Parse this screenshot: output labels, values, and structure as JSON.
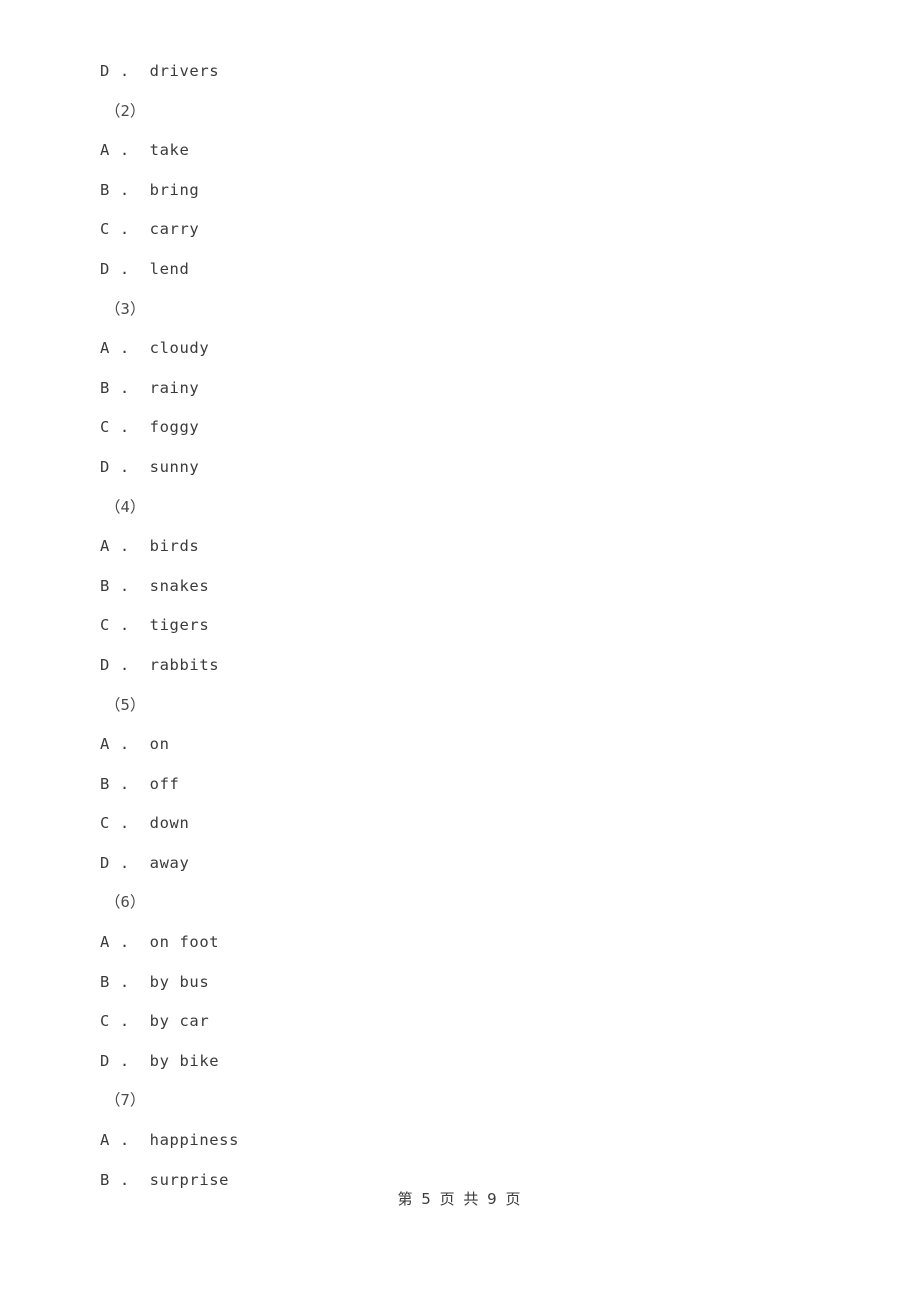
{
  "document": {
    "background_color": "#ffffff",
    "text_color": "#3b3b3b"
  },
  "blocks": [
    {
      "kind": "option",
      "letter": "D",
      "sep": " . ",
      "text": "drivers",
      "full": "D .  drivers"
    },
    {
      "kind": "group",
      "label": "（2）"
    },
    {
      "kind": "option",
      "letter": "A",
      "sep": " . ",
      "text": "take",
      "full": "A .  take"
    },
    {
      "kind": "option",
      "letter": "B",
      "sep": " . ",
      "text": "bring",
      "full": "B .  bring"
    },
    {
      "kind": "option",
      "letter": "C",
      "sep": " . ",
      "text": "carry",
      "full": "C .  carry"
    },
    {
      "kind": "option",
      "letter": "D",
      "sep": " . ",
      "text": "lend",
      "full": "D .  lend"
    },
    {
      "kind": "group",
      "label": "（3）"
    },
    {
      "kind": "option",
      "letter": "A",
      "sep": " . ",
      "text": "cloudy",
      "full": "A .  cloudy"
    },
    {
      "kind": "option",
      "letter": "B",
      "sep": " . ",
      "text": "rainy",
      "full": "B .  rainy"
    },
    {
      "kind": "option",
      "letter": "C",
      "sep": " . ",
      "text": "foggy",
      "full": "C .  foggy"
    },
    {
      "kind": "option",
      "letter": "D",
      "sep": " . ",
      "text": "sunny",
      "full": "D .  sunny"
    },
    {
      "kind": "group",
      "label": "（4）"
    },
    {
      "kind": "option",
      "letter": "A",
      "sep": " . ",
      "text": "birds",
      "full": "A .  birds"
    },
    {
      "kind": "option",
      "letter": "B",
      "sep": " . ",
      "text": "snakes",
      "full": "B .  snakes"
    },
    {
      "kind": "option",
      "letter": "C",
      "sep": " . ",
      "text": "tigers",
      "full": "C .  tigers"
    },
    {
      "kind": "option",
      "letter": "D",
      "sep": " . ",
      "text": "rabbits",
      "full": "D .  rabbits"
    },
    {
      "kind": "group",
      "label": "（5）"
    },
    {
      "kind": "option",
      "letter": "A",
      "sep": " . ",
      "text": "on",
      "full": "A .  on"
    },
    {
      "kind": "option",
      "letter": "B",
      "sep": " . ",
      "text": "off",
      "full": "B .  off"
    },
    {
      "kind": "option",
      "letter": "C",
      "sep": " . ",
      "text": "down",
      "full": "C .  down"
    },
    {
      "kind": "option",
      "letter": "D",
      "sep": " . ",
      "text": "away",
      "full": "D .  away"
    },
    {
      "kind": "group",
      "label": "（6）"
    },
    {
      "kind": "option",
      "letter": "A",
      "sep": " . ",
      "text": "on foot",
      "full": "A .  on foot"
    },
    {
      "kind": "option",
      "letter": "B",
      "sep": " . ",
      "text": "by bus",
      "full": "B .  by bus"
    },
    {
      "kind": "option",
      "letter": "C",
      "sep": " . ",
      "text": "by car",
      "full": "C .  by car"
    },
    {
      "kind": "option",
      "letter": "D",
      "sep": " . ",
      "text": "by bike",
      "full": "D .  by bike"
    },
    {
      "kind": "group",
      "label": "（7）"
    },
    {
      "kind": "option",
      "letter": "A",
      "sep": " . ",
      "text": "happiness",
      "full": "A .  happiness"
    },
    {
      "kind": "option",
      "letter": "B",
      "sep": " . ",
      "text": "surprise",
      "full": "B .  surprise"
    }
  ],
  "footer": {
    "text": "第 5 页 共 9 页",
    "current_page": "5",
    "total_pages": "9"
  }
}
